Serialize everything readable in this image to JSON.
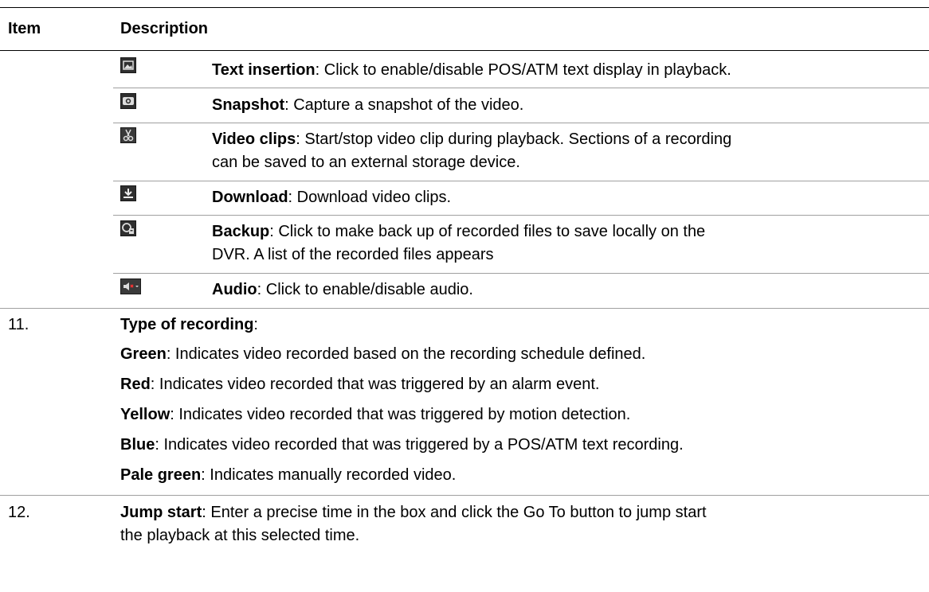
{
  "header": {
    "item": "Item",
    "description": "Description"
  },
  "toolbar_rows": [
    {
      "icon": "text-insertion-icon",
      "term": "Text insertion",
      "lines": [
        ": Click to enable/disable POS/ATM text display in playback."
      ]
    },
    {
      "icon": "camera-icon",
      "term": "Snapshot",
      "lines": [
        ": Capture a snapshot of the video."
      ]
    },
    {
      "icon": "scissors-icon",
      "term": "Video clips",
      "lines": [
        ": Start/stop video clip during playback. Sections of a recording",
        "can be saved to an external storage device."
      ]
    },
    {
      "icon": "download-icon",
      "term": "Download",
      "lines": [
        ": Download video clips."
      ]
    },
    {
      "icon": "backup-icon",
      "term": "Backup",
      "lines": [
        ": Click to make back up of recorded files to save locally on the",
        "DVR. A list of the recorded files appears"
      ]
    },
    {
      "icon": "speaker-muted-icon",
      "term": "Audio",
      "lines": [
        ": Click to enable/disable audio."
      ]
    }
  ],
  "row11": {
    "number": "11.",
    "title": "Type of recording",
    "title_suffix": ":",
    "colors": [
      {
        "term": "Green",
        "text": ": Indicates video recorded based on the recording schedule defined."
      },
      {
        "term": "Red",
        "text": ": Indicates video recorded that was triggered by an alarm event."
      },
      {
        "term": "Yellow",
        "text": ": Indicates video recorded that was triggered by motion detection."
      },
      {
        "term": "Blue",
        "text": ": Indicates video recorded that was triggered by a POS/ATM text recording."
      },
      {
        "term": "Pale green",
        "text": ":  Indicates manually recorded video."
      }
    ]
  },
  "row12": {
    "number": "12.",
    "term": "Jump start",
    "line1": ": Enter a precise time in the box and click the Go To button to jump start",
    "line2": "the playback at this selected time."
  }
}
